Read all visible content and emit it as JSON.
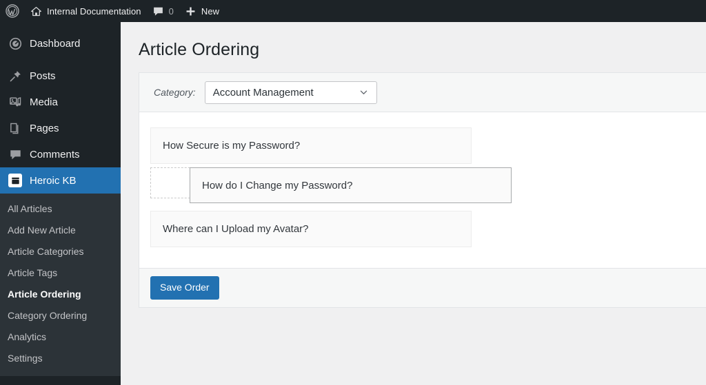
{
  "adminbar": {
    "wp_logo_icon": "wordpress-logo-icon",
    "site_home_icon": "home-icon",
    "site_name": "Internal Documentation",
    "comments_icon": "comment-bubble-icon",
    "comments_count": "0",
    "new_icon": "plus-icon",
    "new_label": "New"
  },
  "sidebar": {
    "items": [
      {
        "label": "Dashboard",
        "icon": "dashboard-icon",
        "current": false
      },
      {
        "label": "Posts",
        "icon": "pin-icon",
        "current": false
      },
      {
        "label": "Media",
        "icon": "media-icon",
        "current": false
      },
      {
        "label": "Pages",
        "icon": "pages-icon",
        "current": false
      },
      {
        "label": "Comments",
        "icon": "comment-bubble-icon",
        "current": false
      },
      {
        "label": "Heroic KB",
        "icon": "book-icon",
        "current": true
      }
    ],
    "submenu": [
      {
        "label": "All Articles",
        "active": false
      },
      {
        "label": "Add New Article",
        "active": false
      },
      {
        "label": "Article Categories",
        "active": false
      },
      {
        "label": "Article Tags",
        "active": false
      },
      {
        "label": "Article Ordering",
        "active": true
      },
      {
        "label": "Category Ordering",
        "active": false
      },
      {
        "label": "Analytics",
        "active": false
      },
      {
        "label": "Settings",
        "active": false
      }
    ]
  },
  "page": {
    "title": "Article Ordering",
    "category_label": "Category:",
    "category_value": "Account Management",
    "category_chevron_icon": "chevron-down-icon",
    "articles": [
      {
        "title": "How Secure is my Password?",
        "state": "item"
      },
      {
        "title": "",
        "state": "placeholder"
      },
      {
        "title": "Where can I Upload my Avatar?",
        "state": "item"
      }
    ],
    "dragged_article": "How do I Change my Password?",
    "save_label": "Save Order"
  },
  "colors": {
    "admin_dark": "#1d2327",
    "submenu_dark": "#2c3338",
    "accent_blue": "#2271b1",
    "body_bg": "#f0f0f1",
    "strip_bg": "#f6f7f7"
  }
}
